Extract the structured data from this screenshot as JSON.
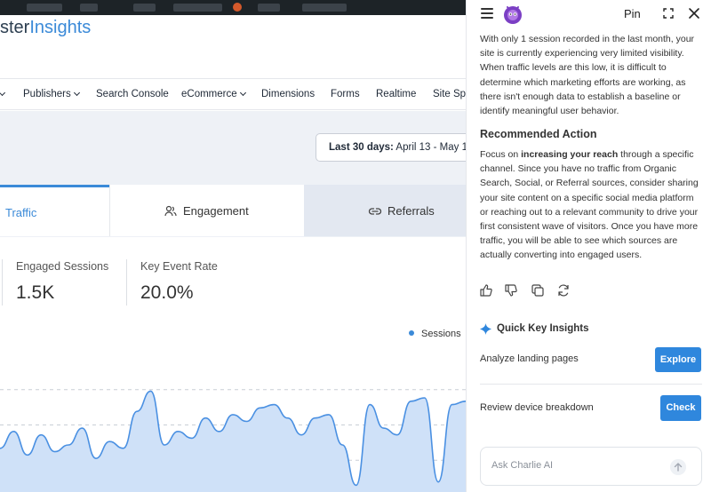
{
  "app": {
    "logo_dark": "ster",
    "logo_blue": "Insights"
  },
  "nav": {
    "items": [
      {
        "label": "Publishers"
      },
      {
        "label": "Search Console"
      },
      {
        "label": "eCommerce"
      },
      {
        "label": "Dimensions"
      },
      {
        "label": "Forms"
      },
      {
        "label": "Realtime"
      },
      {
        "label": "Site Sp"
      }
    ]
  },
  "date_range": {
    "label_bold": "Last 30 days:",
    "value": " April 13 - May 1"
  },
  "tabs": [
    {
      "label": "Traffic",
      "icon": "traffic-icon",
      "active": true
    },
    {
      "label": "Engagement",
      "icon": "users-icon",
      "active": false
    },
    {
      "label": "Referrals",
      "icon": "link-icon",
      "active": false
    }
  ],
  "metrics": [
    {
      "label": "Engaged Sessions",
      "value": "1.5K"
    },
    {
      "label": "Key Event Rate",
      "value": "20.0%"
    }
  ],
  "chart_data": {
    "type": "area",
    "series": [
      {
        "name": "Sessions",
        "values": [
          13,
          18,
          11,
          17,
          12,
          14,
          19,
          10,
          15,
          13,
          24,
          30,
          14,
          18,
          16,
          22,
          18,
          23,
          21,
          25,
          26,
          22,
          17,
          22,
          23,
          14,
          2,
          26,
          19,
          17,
          27,
          28,
          3,
          26,
          27
        ]
      }
    ],
    "ylim": [
      0,
      42
    ],
    "grid": true,
    "legend": "top-right",
    "colors": {
      "line": "#4a90e2",
      "fill": "#cfe1f8"
    }
  },
  "assistant": {
    "pin_label": "Pin",
    "intro_text": "With only 1 session recorded in the last month, your site is currently experiencing very limited visibility. When traffic levels are this low, it is difficult to determine which marketing efforts are working, as there isn't enough data to establish a baseline or identify meaningful user behavior.",
    "recommended_heading": "Recommended Action",
    "rec_text_1": "Focus on ",
    "rec_text_bold": "increasing your reach",
    "rec_text_2": " through a specific channel. Since you have no traffic from Organic Search, Social, or Referral sources, consider sharing your site content on a specific social media platform or reaching out to a relevant community to drive your first consistent wave of visitors. Once you have more traffic, you will be able to see which sources are actually converting into engaged users.",
    "quick_insights_title": "Quick Key Insights",
    "insights": [
      {
        "label": "Analyze landing pages",
        "button": "Explore"
      },
      {
        "label": "Review device breakdown",
        "button": "Check"
      }
    ],
    "ask_placeholder": "Ask Charlie AI"
  },
  "colors": {
    "accent": "#3b8ad8",
    "button": "#2f87dd"
  }
}
